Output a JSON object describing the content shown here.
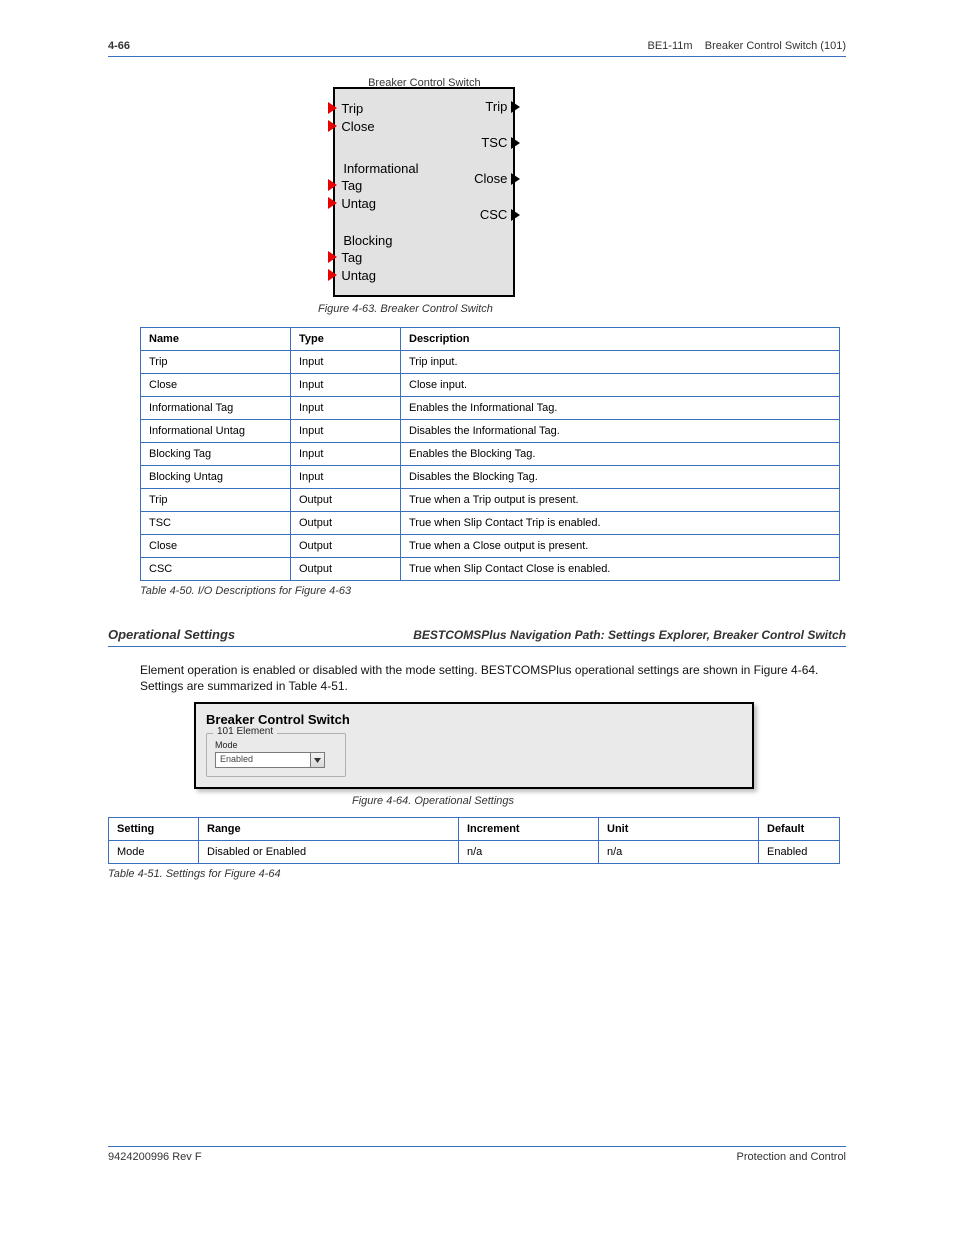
{
  "header": {
    "page_num": "4-66",
    "chapter": "BE1-11m",
    "subject": "Breaker Control Switch (101)"
  },
  "fblock": {
    "title": "Breaker Control Switch",
    "inputs_top": [
      "Trip",
      "Close"
    ],
    "section1": {
      "head": "Informational",
      "inputs": [
        "Tag",
        "Untag"
      ]
    },
    "section2": {
      "head": "Blocking",
      "inputs": [
        "Tag",
        "Untag"
      ]
    },
    "outputs": [
      "Trip",
      "TSC",
      "Close",
      "CSC"
    ]
  },
  "caption1": "Figure 4-63. Breaker Control Switch",
  "io_table": {
    "head": [
      "Name",
      "Type",
      "Description"
    ],
    "rows": [
      [
        "Trip",
        "Input",
        "Trip input."
      ],
      [
        "Close",
        "Input",
        "Close input."
      ],
      [
        "Informational Tag",
        "Input",
        "Enables the Informational Tag."
      ],
      [
        "Informational Untag",
        "Input",
        "Disables the Informational Tag."
      ],
      [
        "Blocking Tag",
        "Input",
        "Enables the Blocking Tag."
      ],
      [
        "Blocking Untag",
        "Input",
        "Disables the Blocking Tag."
      ],
      [
        "Trip",
        "Output",
        "True when a Trip output is present."
      ],
      [
        "TSC",
        "Output",
        "True when Slip Contact Trip is enabled."
      ],
      [
        "Close",
        "Output",
        "True when a Close output is present."
      ],
      [
        "CSC",
        "Output",
        "True when Slip Contact Close is enabled."
      ]
    ]
  },
  "caption_io": "Table 4-50. I/O Descriptions for Figure 4-63",
  "sect2": {
    "left": "Operational Settings",
    "right": "BESTCOMSPlus Navigation Path: Settings Explorer, Breaker Control Switch"
  },
  "para1": "Element operation is enabled or disabled with the mode setting. BESTCOMSPlus operational settings are shown in Figure 4-64. Settings are summarized in Table 4-51.",
  "settings_win": {
    "title": "Breaker Control Switch",
    "group_legend": "101 Element",
    "mode_label": "Mode",
    "mode_value": "Enabled"
  },
  "caption_set_fig": "Figure 4-64. Operational Settings",
  "set_table": {
    "head": [
      "Setting",
      "Range",
      "Increment",
      "Unit",
      "Default"
    ],
    "rows": [
      [
        "Mode",
        "Disabled or Enabled",
        "n/a",
        "n/a",
        "Enabled"
      ]
    ]
  },
  "caption_set_tab": "Table 4-51. Settings for Figure 4-64",
  "footer": {
    "left": "9424200996 Rev F",
    "right": "Protection and Control"
  }
}
